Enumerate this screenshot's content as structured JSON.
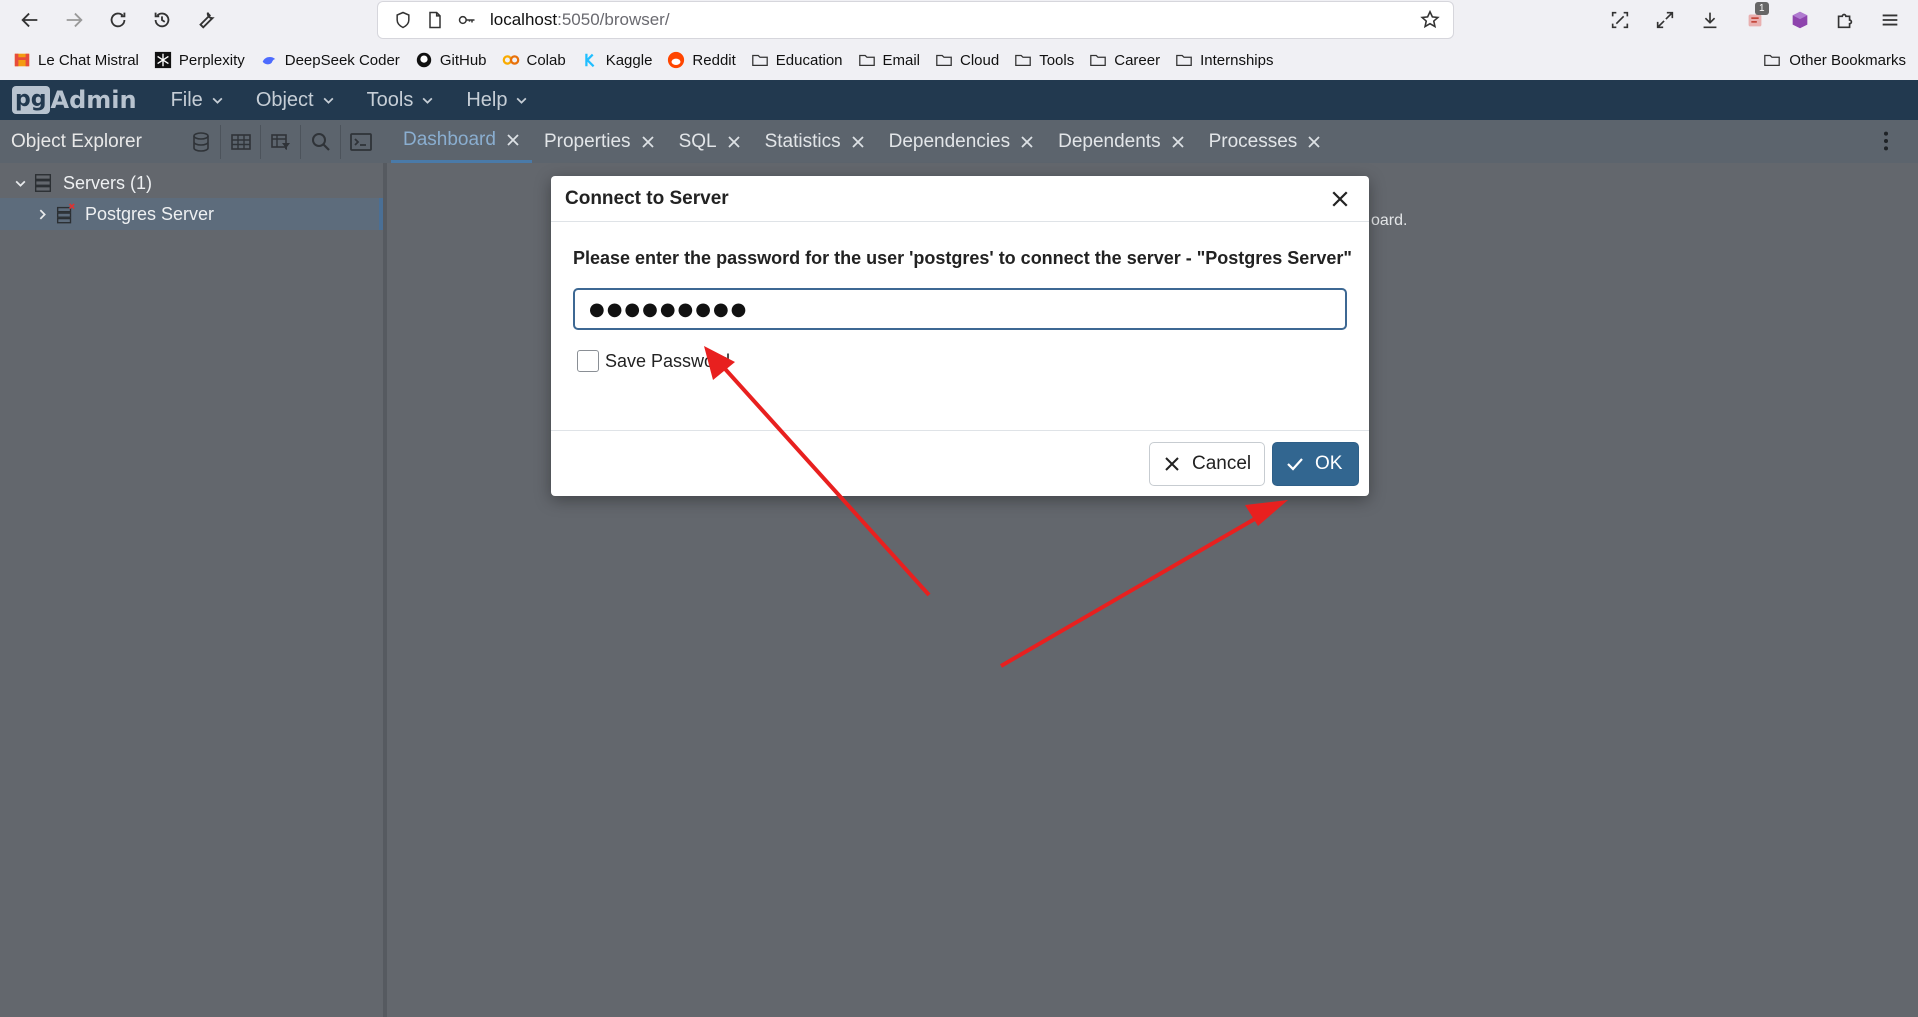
{
  "browser": {
    "url_host": "localhost",
    "url_path": ":5050/browser/",
    "extension_badge": "1"
  },
  "bookmarks": [
    {
      "label": "Le Chat Mistral",
      "icon": "mistral-icon"
    },
    {
      "label": "Perplexity",
      "icon": "perplexity-icon"
    },
    {
      "label": "DeepSeek Coder",
      "icon": "deepseek-icon"
    },
    {
      "label": "GitHub",
      "icon": "github-icon"
    },
    {
      "label": "Colab",
      "icon": "colab-icon"
    },
    {
      "label": "Kaggle",
      "icon": "kaggle-icon"
    },
    {
      "label": "Reddit",
      "icon": "reddit-icon"
    },
    {
      "label": "Education",
      "icon": "folder-icon"
    },
    {
      "label": "Email",
      "icon": "folder-icon"
    },
    {
      "label": "Cloud",
      "icon": "folder-icon"
    },
    {
      "label": "Tools",
      "icon": "folder-icon"
    },
    {
      "label": "Career",
      "icon": "folder-icon"
    },
    {
      "label": "Internships",
      "icon": "folder-icon"
    }
  ],
  "other_bookmarks": "Other Bookmarks",
  "app": {
    "logo_pg": "pg",
    "logo_admin": "Admin",
    "menu": [
      "File",
      "Object",
      "Tools",
      "Help"
    ]
  },
  "object_explorer": {
    "title": "Object Explorer",
    "tree": {
      "servers": "Servers (1)",
      "server": "Postgres Server"
    }
  },
  "tabs": [
    "Dashboard",
    "Properties",
    "SQL",
    "Statistics",
    "Dependencies",
    "Dependents",
    "Processes"
  ],
  "main": {
    "background_text": "oard."
  },
  "dialog": {
    "title": "Connect to Server",
    "prompt": "Please enter the password for the user 'postgres' to connect the server - \"Postgres Server\"",
    "password_value": "●●●●●●●●●",
    "save_password_label": "Save Password",
    "cancel_label": "Cancel",
    "ok_label": "OK"
  },
  "colors": {
    "header": "#22394f",
    "primary": "#326690",
    "annotation_arrow": "#e8201f"
  }
}
